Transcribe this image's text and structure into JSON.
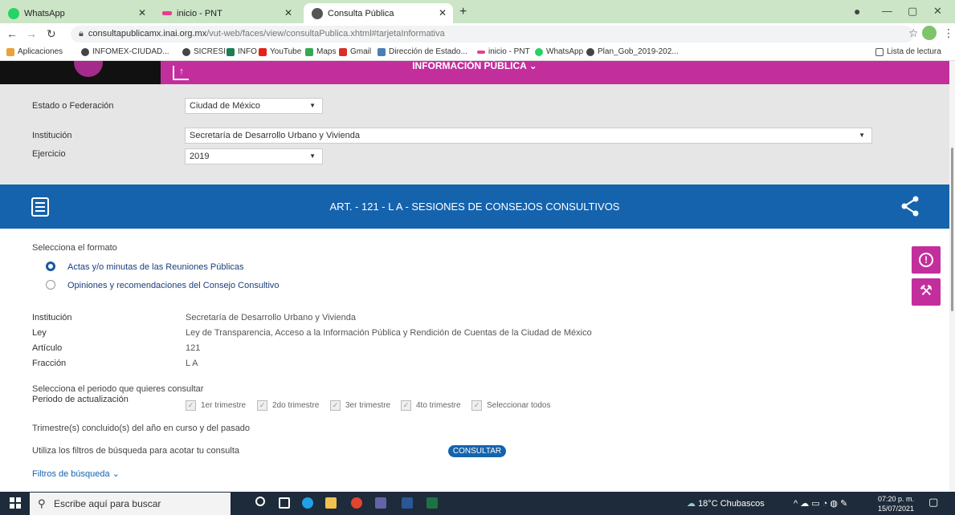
{
  "browser": {
    "tabs": [
      {
        "label": "WhatsApp"
      },
      {
        "label": "inicio - PNT"
      },
      {
        "label": "Consulta Pública"
      }
    ],
    "new_tab": "+",
    "url_host": "consultapublicamx.inai.org.mx",
    "url_path": "/vut-web/faces/view/consultaPublica.xhtml#tarjetaInformativa",
    "bookmarks": [
      {
        "label": "Aplicaciones",
        "color": "#e8a33a"
      },
      {
        "label": "INFOMEX-CIUDAD...",
        "color": "#444444"
      },
      {
        "label": "SICRESI",
        "color": "#444444"
      },
      {
        "label": "INFO",
        "color": "#1c7c54"
      },
      {
        "label": "YouTube",
        "color": "#e62117"
      },
      {
        "label": "Maps",
        "color": "#34a853"
      },
      {
        "label": "Gmail",
        "color": "#d93025"
      },
      {
        "label": "Dirección de Estado...",
        "color": "#4a7fb5"
      },
      {
        "label": "inicio - PNT",
        "color": "#e83e8c"
      },
      {
        "label": "WhatsApp",
        "color": "#25d366"
      },
      {
        "label": "Plan_Gob_2019-202...",
        "color": "#444444"
      }
    ],
    "reading_list": "Lista de lectura"
  },
  "page": {
    "hero_title": "INFORMACIÓN PÚBLICA ⌄",
    "filters": {
      "estado_label": "Estado o Federación",
      "estado_value": "Ciudad de México",
      "institucion_label": "Institución",
      "institucion_value": "Secretaría de Desarrollo Urbano y Vivienda",
      "ejercicio_label": "Ejercicio",
      "ejercicio_value": "2019"
    },
    "banner_title": "ART. - 121 - L A - SESIONES DE CONSEJOS CONSULTIVOS",
    "formato_label": "Selecciona el formato",
    "formato_options": [
      {
        "label": "Actas y/o minutas de las Reuniones Públicas",
        "selected": true
      },
      {
        "label": "Opiniones y recomendaciones del Consejo Consultivo",
        "selected": false
      }
    ],
    "info": {
      "institucion_label": "Institución",
      "institucion_value": "Secretaría de Desarrollo Urbano y Vivienda",
      "ley_label": "Ley",
      "ley_value": "Ley de Transparencia, Acceso a la Información Pública y Rendición de Cuentas de la Ciudad de México",
      "articulo_label": "Artículo",
      "articulo_value": "121",
      "fraccion_label": "Fracción",
      "fraccion_value": "L A"
    },
    "periodo_prompt": "Selecciona el periodo que quieres consultar",
    "periodo_label": "Periodo de actualización",
    "periodo_options": [
      "1er trimestre",
      "2do trimestre",
      "3er trimestre",
      "4to trimestre",
      "Seleccionar todos"
    ],
    "trimestres_note": "Trimestre(s) concluido(s) del año en curso y del pasado",
    "filtros_note": "Utiliza los filtros de búsqueda para acotar tu consulta",
    "consultar_label": "CONSULTAR",
    "filtros_busqueda": "Filtros de búsqueda ⌄"
  },
  "taskbar": {
    "search_placeholder": "Escribe aquí para buscar",
    "weather": "18°C Chubascos",
    "time": "07:20 p. m.",
    "date": "15/07/2021"
  },
  "colors": {
    "brand_magenta": "#c32e9d",
    "brand_blue": "#1563ad",
    "tab_strip": "#cbe5c6"
  }
}
